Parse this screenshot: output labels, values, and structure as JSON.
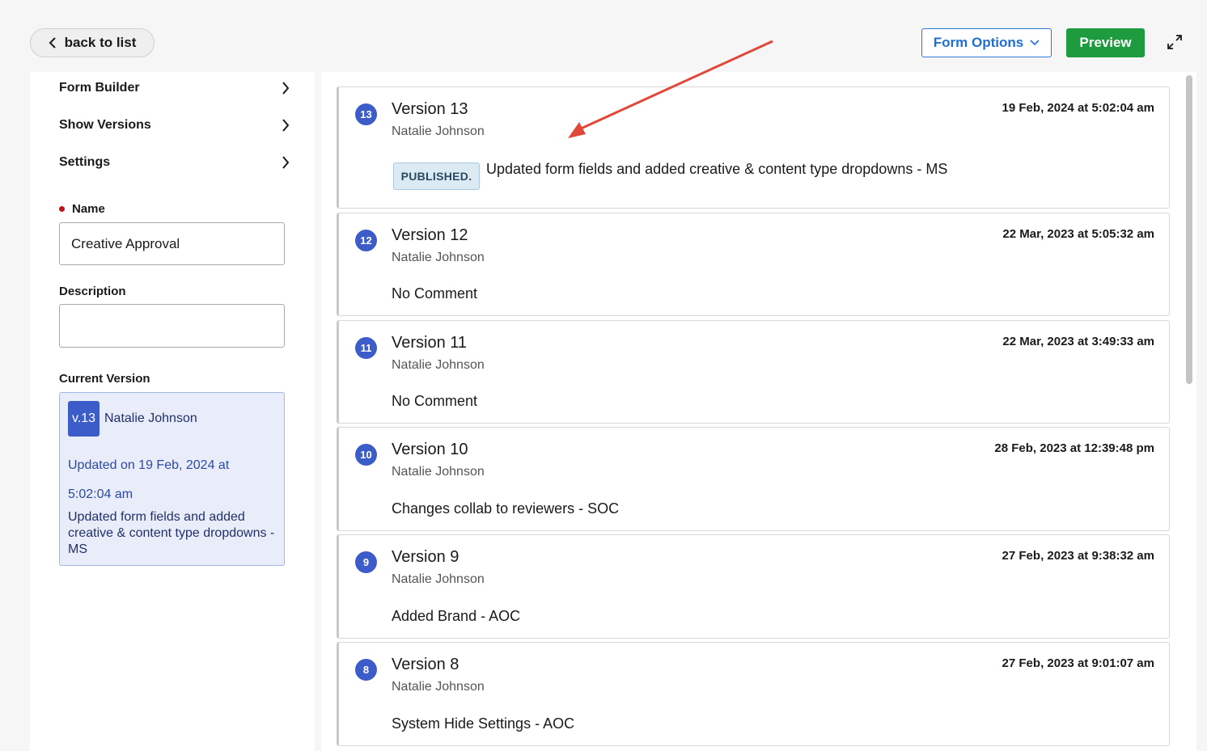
{
  "toolbar": {
    "back_label": "back to list",
    "form_options_label": "Form Options",
    "preview_label": "Preview"
  },
  "sidebar": {
    "items": [
      {
        "label": "Form Builder"
      },
      {
        "label": "Show Versions"
      },
      {
        "label": "Settings"
      }
    ],
    "name_label": "Name",
    "name_value": "Creative Approval",
    "description_label": "Description",
    "description_value": "",
    "current_version_label": "Current Version",
    "current": {
      "badge": "v.13",
      "author": "Natalie Johnson",
      "updated": "Updated on 19 Feb, 2024 at 5:02:04 am",
      "comment": "Updated form fields and added creative & content type dropdowns - MS"
    }
  },
  "versions": [
    {
      "num": "13",
      "title": "Version 13",
      "author": "Natalie Johnson",
      "date": "19 Feb, 2024 at 5:02:04 am",
      "status": "PUBLISHED.",
      "comment": "Updated form fields and added creative & content type dropdowns - MS"
    },
    {
      "num": "12",
      "title": "Version 12",
      "author": "Natalie Johnson",
      "date": "22 Mar, 2023 at 5:05:32 am",
      "comment": "No Comment"
    },
    {
      "num": "11",
      "title": "Version 11",
      "author": "Natalie Johnson",
      "date": "22 Mar, 2023 at 3:49:33 am",
      "comment": "No Comment"
    },
    {
      "num": "10",
      "title": "Version 10",
      "author": "Natalie Johnson",
      "date": "28 Feb, 2023 at 12:39:48 pm",
      "comment": "Changes collab to reviewers - SOC"
    },
    {
      "num": "9",
      "title": "Version 9",
      "author": "Natalie Johnson",
      "date": "27 Feb, 2023 at 9:38:32 am",
      "comment": "Added Brand - AOC"
    },
    {
      "num": "8",
      "title": "Version 8",
      "author": "Natalie Johnson",
      "date": "27 Feb, 2023 at 9:01:07 am",
      "comment": "System Hide Settings - AOC"
    }
  ],
  "colors": {
    "accent_blue": "#3b5cc9",
    "preview_green": "#1e9b3f",
    "annotation_red": "#e0483a",
    "required_dot": "#c0121f"
  },
  "icons": [
    "chevron-left-icon",
    "chevron-down-icon",
    "expand-icon",
    "chevron-right-icon"
  ]
}
